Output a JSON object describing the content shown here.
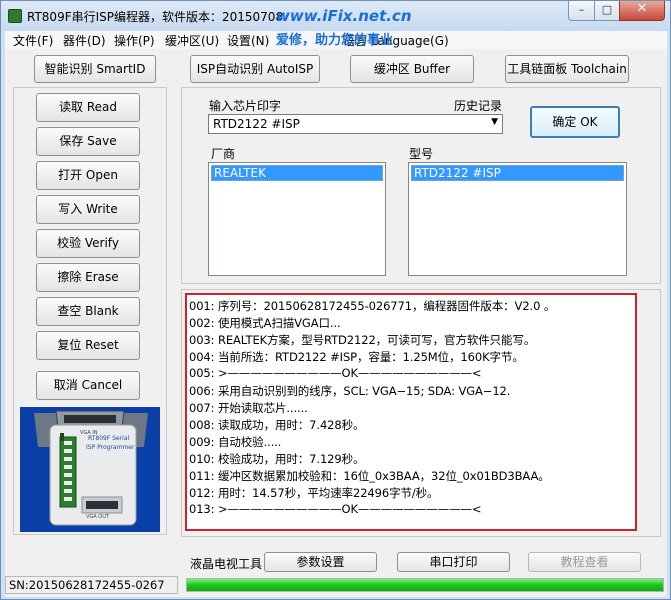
{
  "window": {
    "title": "RT809F串行ISP编程器，软件版本：20150708",
    "watermark_url": "www.iFix.net.cn",
    "watermark_slogan": "爱修，助力您的事业",
    "min_glyph": "–",
    "max_glyph": "□",
    "close_glyph": "✕"
  },
  "menu": [
    {
      "label": "文件(F)"
    },
    {
      "label": "器件(D)"
    },
    {
      "label": "操作(P)"
    },
    {
      "label": "缓冲区(U)"
    },
    {
      "label": "设置(N)"
    },
    {
      "label": "语言 Language(G)"
    }
  ],
  "toolbar": {
    "smartid": "智能识别 SmartID",
    "autoisp": "ISP自动识别 AutoISP",
    "buffer": "缓冲区 Buffer",
    "toolchain": "工具链面板 Toolchain"
  },
  "actions": {
    "read": "读取 Read",
    "save": "保存 Save",
    "open": "打开 Open",
    "write": "写入 Write",
    "verify": "校验 Verify",
    "erase": "擦除 Erase",
    "blank": "查空 Blank",
    "reset": "复位 Reset",
    "cancel": "取消 Cancel"
  },
  "chip_select": {
    "input_label": "输入芯片印字",
    "history_label": "历史记录",
    "value": "RTD2122 #ISP",
    "ok_button": "确定 OK",
    "vendor_label": "厂商",
    "model_label": "型号",
    "vendor_selected": "REALTEK",
    "model_selected": "RTD2122 #ISP"
  },
  "log": [
    "001: 序列号：20150628172455-026771，编程器固件版本：V2.0 。",
    "002: 使用模式A扫描VGA口...",
    "003: REALTEK方案，型号RTD2122，可读可写，官方软件只能写。",
    "004: 当前所选：RTD2122 #ISP，容量：1.25M位，160K字节。",
    "005: >——————————OK——————————<",
    "006: 采用自动识别到的线序，SCL: VGA−15; SDA: VGA−12.",
    "007: 开始读取芯片......",
    "008: 读取成功，用时：7.428秒。",
    "009: 自动校验.....",
    "010: 校验成功，用时：7.129秒。",
    "011: 缓冲区数据累加校验和：16位_0x3BAA，32位_0x01BD3BAA。",
    "012: 用时：14.57秒，平均速率22496字节/秒。",
    "013: >——————————OK——————————<"
  ],
  "bottom_tools": {
    "lcd_tool_label": "液晶电视工具",
    "params_button": "参数设置",
    "serial_print_button": "串口打印",
    "tutorial_button": "教程查看"
  },
  "photo": {
    "device_text_1": "RT809F Serial",
    "device_text_2": "ISP Programmer",
    "port_label_top": "VGA IN",
    "port_label_bottom": "VGA OUT"
  },
  "status": {
    "serial": "SN:20150628172455-0267",
    "progress": 1.0
  },
  "colors": {
    "log_border": "#c8242a",
    "selection": "#3399ff",
    "progress": "#1bc51b",
    "watermark": "#1a6fd8"
  }
}
